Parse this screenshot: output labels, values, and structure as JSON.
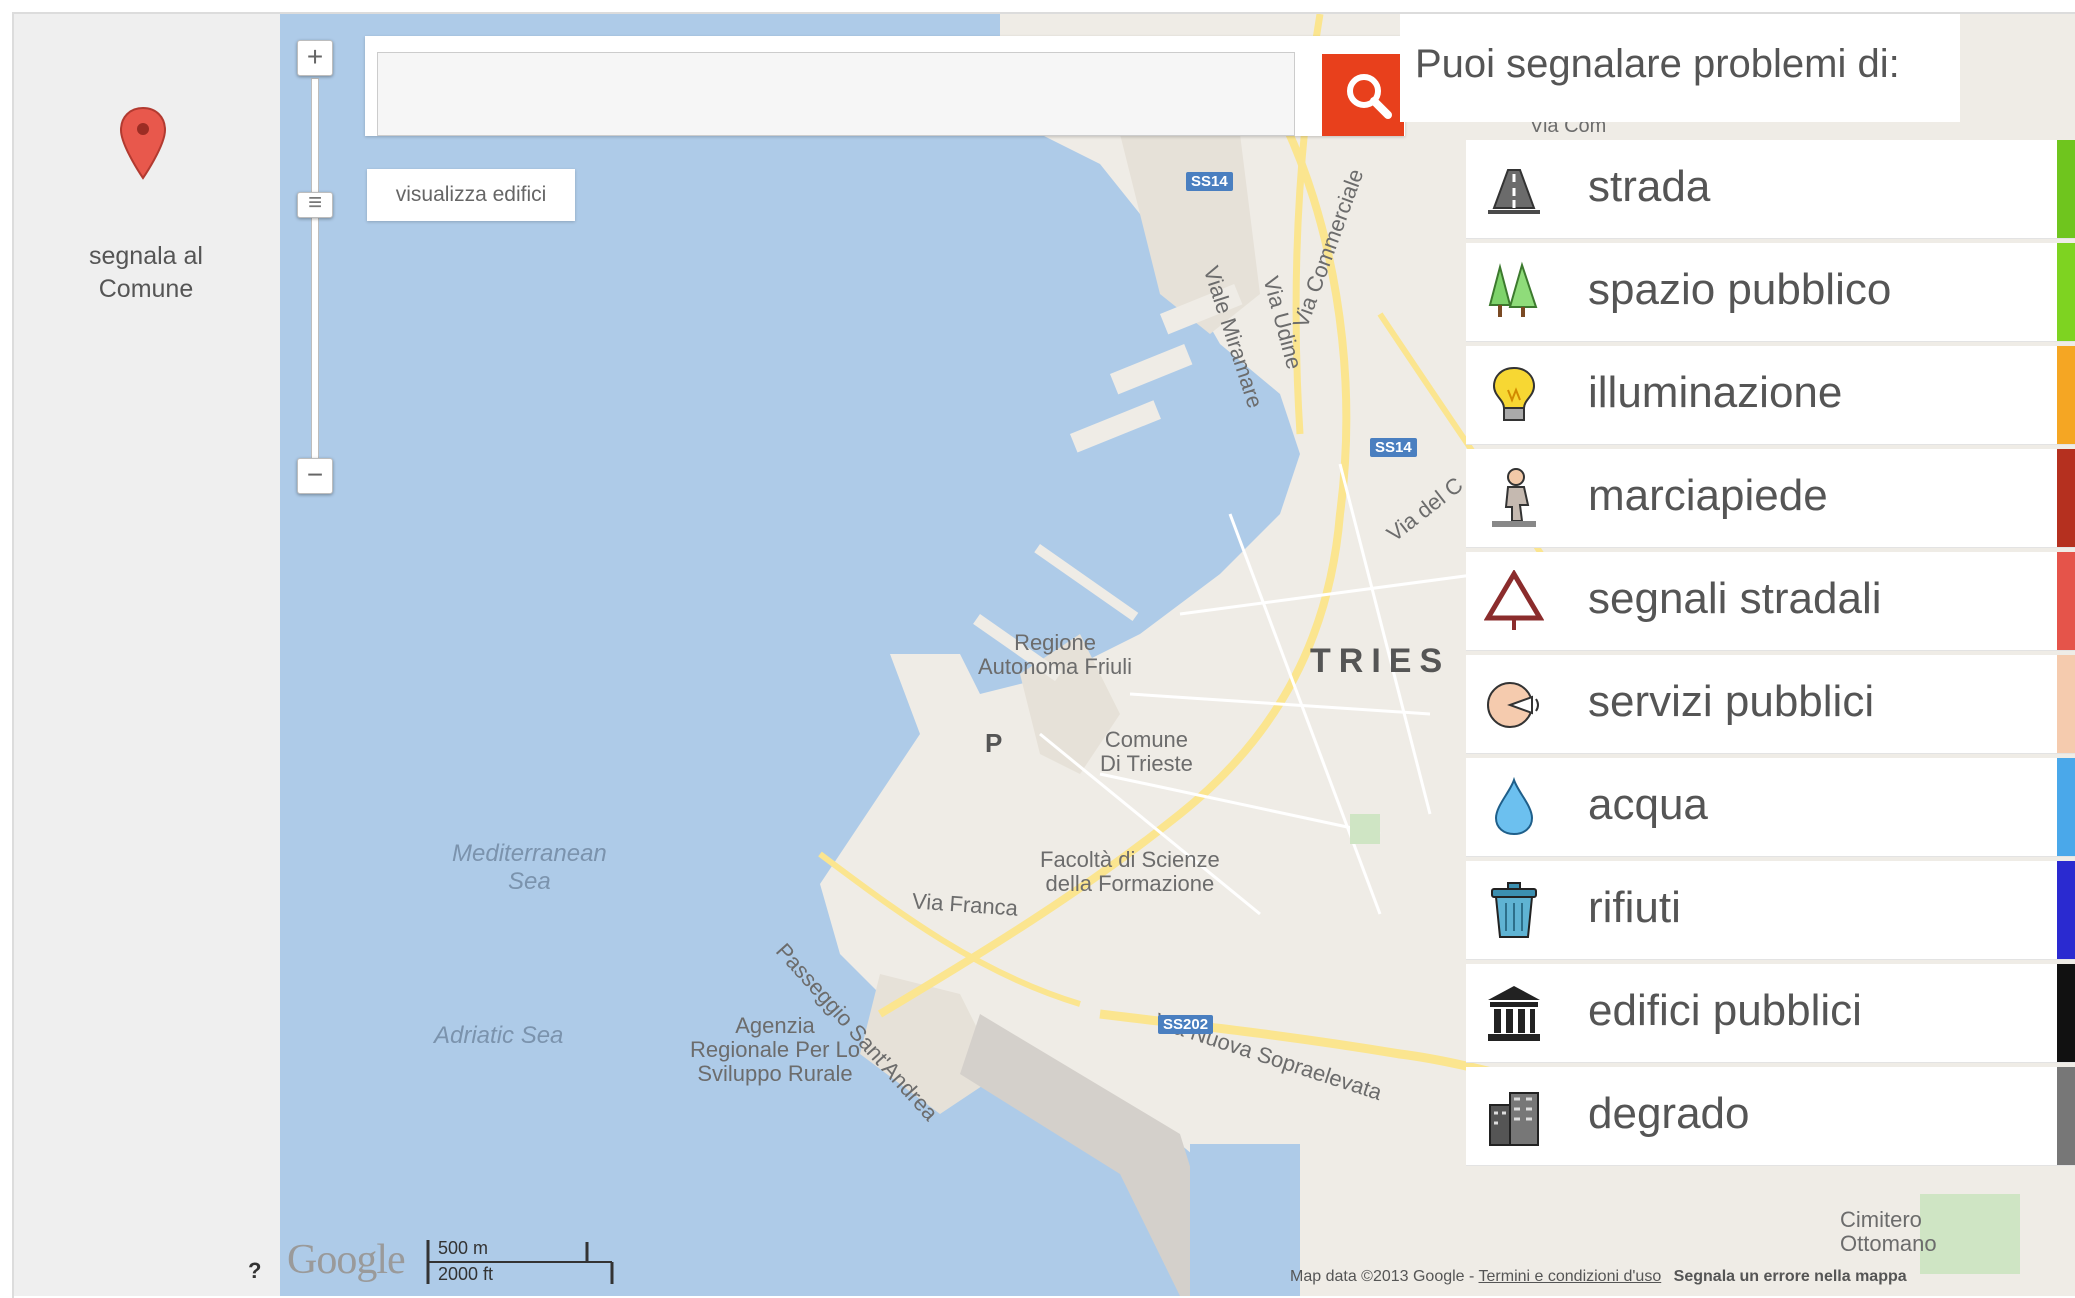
{
  "sidebar": {
    "label_line1": "segnala al",
    "label_line2": "Comune",
    "help": "?"
  },
  "search": {
    "value": "",
    "placeholder": ""
  },
  "map": {
    "buildings_toggle": "visualizza edifici",
    "zoom_in": "+",
    "zoom_out": "−",
    "labels": {
      "regione1": "Regione",
      "regione2": "Autonoma Friuli",
      "comune1": "Comune",
      "comune2": "Di Trieste",
      "facolta1": "Facoltà di Scienze",
      "facolta2": "della Formazione",
      "via_franca": "Via Franca",
      "passeggio": "Passeggio Sant'Andrea",
      "agenzia1": "Agenzia",
      "agenzia2": "Regionale Per Lo",
      "agenzia3": "Sviluppo Rurale",
      "med1": "Mediterranean",
      "med2": "Sea",
      "adriatic": "Adriatic Sea",
      "trieste": "TRIES",
      "via_nuova": "Via Nuova Sopraelevata",
      "viale_miramare": "Viale Miramare",
      "via_udine": "Via Udine",
      "via_commerciale": "Via Commerciale",
      "via_del": "Via del C",
      "via_com": "Via Com",
      "cimitero1": "Cimitero",
      "cimitero2": "Ottomano",
      "p": "P",
      "ss14a": "SS14",
      "ss14b": "SS14",
      "ss202": "SS202"
    },
    "google": "Google",
    "scale_m": "500 m",
    "scale_ft": "2000 ft",
    "footer_data": "Map data ©2013 Google -",
    "footer_terms": "Termini e condizioni d'uso",
    "footer_report": "Segnala un errore nella mappa"
  },
  "panel": {
    "title": "Puoi segnalare problemi di:",
    "categories": [
      {
        "label": "strada",
        "icon": "road-icon",
        "color": "#6fc51e"
      },
      {
        "label": "spazio pubblico",
        "icon": "trees-icon",
        "color": "#7ed321"
      },
      {
        "label": "illuminazione",
        "icon": "lightbulb-icon",
        "color": "#f5a623"
      },
      {
        "label": "marciapiede",
        "icon": "pedestrian-icon",
        "color": "#b5301f"
      },
      {
        "label": "segnali stradali",
        "icon": "warning-sign-icon",
        "color": "#e5544a"
      },
      {
        "label": "servizi pubblici",
        "icon": "public-services-icon",
        "color": "#f5cbae"
      },
      {
        "label": "acqua",
        "icon": "water-drop-icon",
        "color": "#4aa8ea"
      },
      {
        "label": "rifiuti",
        "icon": "trash-bin-icon",
        "color": "#2a2ad0"
      },
      {
        "label": "edifici pubblici",
        "icon": "public-building-icon",
        "color": "#111111"
      },
      {
        "label": "degrado",
        "icon": "decay-icon",
        "color": "#777777"
      }
    ]
  }
}
